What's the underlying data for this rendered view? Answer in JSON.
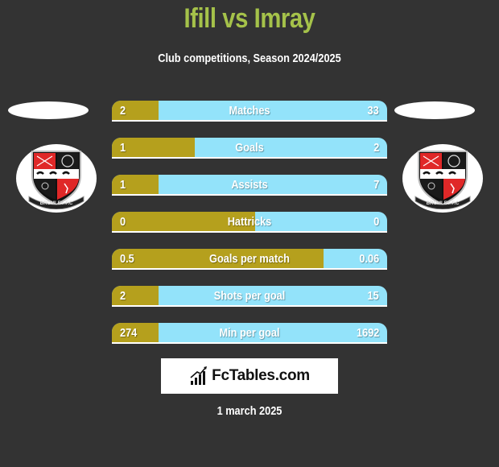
{
  "header": {
    "title": "Ifill vs Imray",
    "subtitle": "Club competitions, Season 2024/2025"
  },
  "teams": {
    "left": {
      "crest_icon": "bromley-fc-crest-icon",
      "crest_text": "BROMLEY-F.C"
    },
    "right": {
      "crest_icon": "bromley-fc-crest-icon",
      "crest_text": "BROMLEY-F.C"
    }
  },
  "colors": {
    "left_fill": "#b5a01d",
    "right_fill": "#93e3fa",
    "title": "#a5c24a",
    "background": "#333333"
  },
  "stats": [
    {
      "label": "Matches",
      "left": "2",
      "right": "33",
      "left_fill_fraction": 0.17
    },
    {
      "label": "Goals",
      "left": "1",
      "right": "2",
      "left_fill_fraction": 0.3
    },
    {
      "label": "Assists",
      "left": "1",
      "right": "7",
      "left_fill_fraction": 0.17
    },
    {
      "label": "Hattricks",
      "left": "0",
      "right": "0",
      "left_fill_fraction": 0.52
    },
    {
      "label": "Goals per match",
      "left": "0.5",
      "right": "0.06",
      "left_fill_fraction": 0.77
    },
    {
      "label": "Shots per goal",
      "left": "2",
      "right": "15",
      "left_fill_fraction": 0.17
    },
    {
      "label": "Min per goal",
      "left": "274",
      "right": "1692",
      "left_fill_fraction": 0.17
    }
  ],
  "brand": {
    "name": "FcTables.com",
    "icon": "bar-chart-icon"
  },
  "footer": {
    "date": "1 march 2025"
  }
}
